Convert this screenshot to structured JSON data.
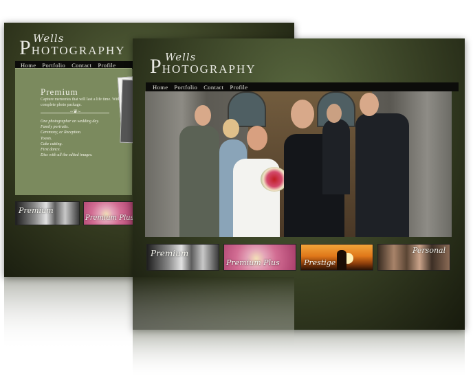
{
  "brand": {
    "script": "Wells",
    "initial": "P",
    "rest": "HOTOGRAPHY"
  },
  "nav": {
    "items": [
      "Home",
      "Portfolio",
      "Contact",
      "Profile"
    ]
  },
  "premium_page": {
    "title": "Premium",
    "description": "Capture memories that will last a life time. With this complete photo package.",
    "features": [
      "One photographer on wedding day.",
      "Family portraits.",
      "Ceremony, or Reception.",
      "Toasts.",
      "Cake cutting.",
      "First dance.",
      "Disc with all the edited images."
    ]
  },
  "packages": [
    {
      "label": "Premium"
    },
    {
      "label": "Premium Plus"
    },
    {
      "label": "Prestige"
    },
    {
      "label": "Personal"
    }
  ],
  "colors": {
    "nav_bg": "#0c0c0a",
    "panel_green": "#7b8a5e",
    "frame_dark": "#2d331d"
  }
}
